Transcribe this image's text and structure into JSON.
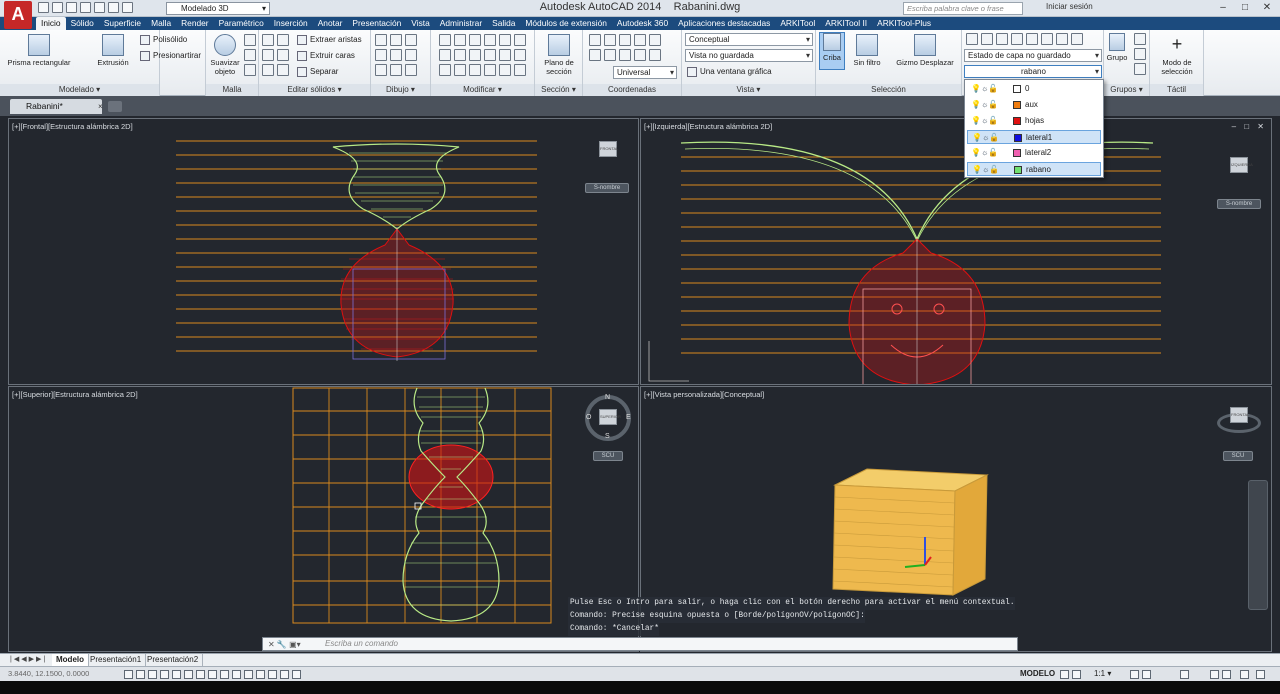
{
  "app": {
    "title": "Autodesk AutoCAD 2014",
    "filename": "Rabanini.dwg",
    "workspace": "Modelado 3D",
    "search_placeholder": "Escriba palabra clave o frase",
    "signin": "Iniciar sesión",
    "logo": "A",
    "win_min": "–",
    "win_max": "□",
    "win_close": "✕"
  },
  "tabs": [
    "Inicio",
    "Sólido",
    "Superficie",
    "Malla",
    "Render",
    "Paramétrico",
    "Inserción",
    "Anotar",
    "Presentación",
    "Vista",
    "Administrar",
    "Salida",
    "Módulos de extensión",
    "Autodesk 360",
    "Aplicaciones destacadas",
    "ARKITool",
    "ARKITool II",
    "ARKITool-Plus"
  ],
  "ribbon": {
    "modelado": {
      "title": "Modelado ▾",
      "prisma": "Prisma rectangular",
      "extrusion": "Extrusión",
      "polisolido": "Polisólido",
      "presionartirar": "Presionartirar"
    },
    "malla": {
      "title": "Malla",
      "suavizar": "Suavizar objeto"
    },
    "editar": {
      "title": "Editar sólidos ▾",
      "extraer": "Extraer aristas",
      "extruir": "Extruir caras",
      "separar": "Separar"
    },
    "dibujo": {
      "title": "Dibujo ▾"
    },
    "modificar": {
      "title": "Modificar ▾"
    },
    "seccion": {
      "title": "Sección ▾",
      "plano": "Plano de sección"
    },
    "coordenadas": {
      "title": "Coordenadas",
      "universal": "Universal"
    },
    "vista": {
      "title": "Vista ▾",
      "estilo": "Conceptual",
      "vista": "Vista no guardada",
      "ventana": "Una ventana gráfica"
    },
    "seleccion": {
      "title": "Selección",
      "criba": "Criba",
      "sinfiltro": "Sin filtro",
      "gizmo": "Gizmo Desplazar"
    },
    "capas": {
      "estado": "Estado de capa no guardado",
      "actual": "rabano"
    },
    "grupos": {
      "title": "Grupos ▾",
      "grupo": "Grupo"
    },
    "tactil": {
      "title": "Táctil",
      "modo": "Modo de selección"
    }
  },
  "layers": [
    {
      "name": "0",
      "color": "#ffffff"
    },
    {
      "name": "aux",
      "color": "#ef7d10"
    },
    {
      "name": "hojas",
      "color": "#e01010"
    },
    {
      "name": "lateral1",
      "color": "#1010e0"
    },
    {
      "name": "lateral2",
      "color": "#f060b0"
    },
    {
      "name": "rabano",
      "color": "#70e070"
    }
  ],
  "file_tab": {
    "name": "Rabanini*",
    "close": "×"
  },
  "viewports": {
    "front": {
      "label": "[+][Frontal][Estructura alámbrica 2D]",
      "cube": "FRONTAL",
      "ucs": "S-nombre"
    },
    "left": {
      "label": "[+][Izquierda][Estructura alámbrica 2D]",
      "cube": "IZQUIERDA",
      "ucs": "S-nombre"
    },
    "top": {
      "label": "[+][Superior][Estructura alámbrica 2D]",
      "cube": "SUPERIOR",
      "ucs": "SCU",
      "n": "N",
      "s": "S",
      "e": "E",
      "o": "O"
    },
    "persp": {
      "label": "[+][Vista personalizada][Conceptual]",
      "cube": "FRONTAL",
      "ucs": "SCU"
    },
    "ctl": "– □ ✕"
  },
  "command": {
    "history": [
      "Pulse Esc o Intro para salir, o haga clic con el botón derecho para activar el menú contextual.",
      "Comando: Precise esquina opuesta o [Borde/polígonOV/polígonOC]:",
      "Comando: *Cancelar*"
    ],
    "placeholder": "Escriba un comando",
    "icons": "✕ 🔧 ▣▾"
  },
  "layout_tabs": [
    "Modelo",
    "Presentación1",
    "Presentación2"
  ],
  "status": {
    "coords": "3.8440, 12.1500, 0.0000",
    "model": "MODELO",
    "scale": "1:1 ▾"
  }
}
